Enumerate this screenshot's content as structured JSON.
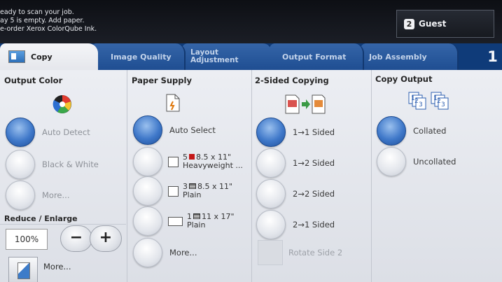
{
  "status": {
    "messages": [
      "eady to scan your job.",
      "ay 5 is empty. Add paper.",
      "e-order Xerox ColorQube Ink."
    ],
    "user_label": "Guest",
    "user_icon": "user-badge-icon"
  },
  "tabs": [
    {
      "label": "Copy",
      "active": true
    },
    {
      "label": "Image Quality",
      "active": false
    },
    {
      "label": "Layout Adjustment",
      "line1": "Layout",
      "line2": "Adjustment",
      "active": false
    },
    {
      "label": "Output Format",
      "active": false
    },
    {
      "label": "Job Assembly",
      "active": false
    }
  ],
  "page_indicator": "1",
  "output_color": {
    "title": "Output Color",
    "icon": "color-wheel-icon",
    "options": [
      {
        "label": "Auto Detect",
        "selected": true
      },
      {
        "label": "Black & White",
        "selected": false
      },
      {
        "label": "More...",
        "selected": false
      }
    ]
  },
  "paper_supply": {
    "title": "Paper Supply",
    "icon": "paper-stack-icon",
    "options": [
      {
        "label": "Auto Select",
        "selected": true
      },
      {
        "tray": "5",
        "size": "8.5 x 11\"",
        "type": "Heavyweight ...",
        "selected": false
      },
      {
        "tray": "3",
        "size": "8.5 x 11\"",
        "type": "Plain",
        "selected": false
      },
      {
        "tray": "1",
        "size": "11 x 17\"",
        "type": "Plain",
        "selected": false
      },
      {
        "label": "More...",
        "selected": false
      }
    ]
  },
  "two_sided": {
    "title": "2-Sided Copying",
    "icon": "duplex-icon",
    "options": [
      {
        "label": "1→1 Sided",
        "selected": true
      },
      {
        "label": "1→2 Sided",
        "selected": false
      },
      {
        "label": "2→2 Sided",
        "selected": false
      },
      {
        "label": "2→1 Sided",
        "selected": false
      }
    ],
    "rotate_label": "Rotate Side 2"
  },
  "copy_output": {
    "title": "Copy Output",
    "icon": "collate-icon",
    "options": [
      {
        "label": "Collated",
        "selected": true
      },
      {
        "label": "Uncollated",
        "selected": false
      }
    ]
  },
  "reduce_enlarge": {
    "title": "Reduce / Enlarge",
    "value": "100%",
    "minus": "−",
    "plus": "+",
    "more_label": "More..."
  },
  "colors": {
    "tab_blue": "#1f4e92",
    "selected_blue": "#3f78c9",
    "status_bar": "#0d0f14"
  }
}
